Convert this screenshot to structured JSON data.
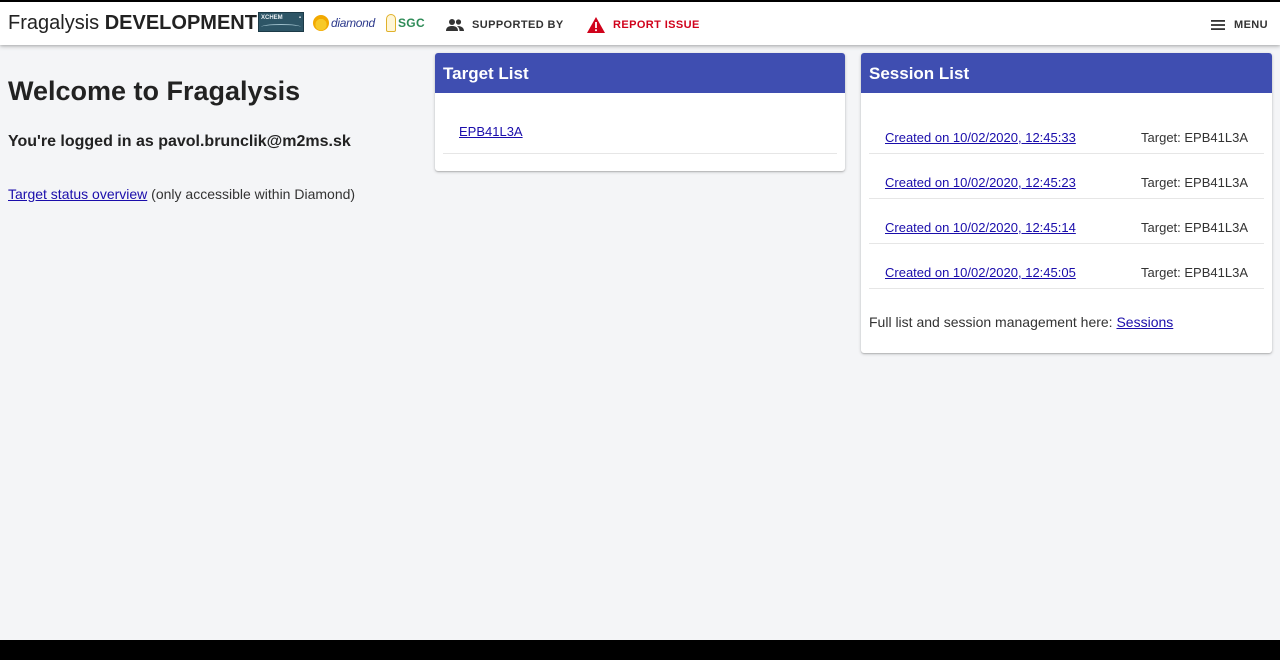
{
  "header": {
    "brand_name": "Fragalysis",
    "brand_env": "DEVELOPMENT",
    "logos": {
      "xchem": "XCHEM",
      "diamond": "diamond",
      "sgc": "SGC"
    },
    "supported_by_label": "SUPPORTED BY",
    "report_issue_label": "REPORT ISSUE",
    "menu_label": "MENU"
  },
  "welcome": {
    "title": "Welcome to Fragalysis",
    "logged_in_text": "You're logged in as pavol.brunclik@m2ms.sk",
    "status_link": "Target status overview",
    "status_note": " (only accessible within Diamond)"
  },
  "target_list": {
    "title": "Target List",
    "items": [
      {
        "label": "EPB41L3A"
      }
    ]
  },
  "session_list": {
    "title": "Session List",
    "items": [
      {
        "created": "Created on 10/02/2020, 12:45:33",
        "target": "Target: EPB41L3A"
      },
      {
        "created": "Created on 10/02/2020, 12:45:23",
        "target": "Target: EPB41L3A"
      },
      {
        "created": "Created on 10/02/2020, 12:45:14",
        "target": "Target: EPB41L3A"
      },
      {
        "created": "Created on 10/02/2020, 12:45:05",
        "target": "Target: EPB41L3A"
      }
    ],
    "footer_text": "Full list and session management here: ",
    "footer_link": "Sessions"
  },
  "colors": {
    "accent": "#3f4eb1",
    "danger": "#d0021b",
    "link": "#1a0dab",
    "background": "#f4f5f7"
  }
}
